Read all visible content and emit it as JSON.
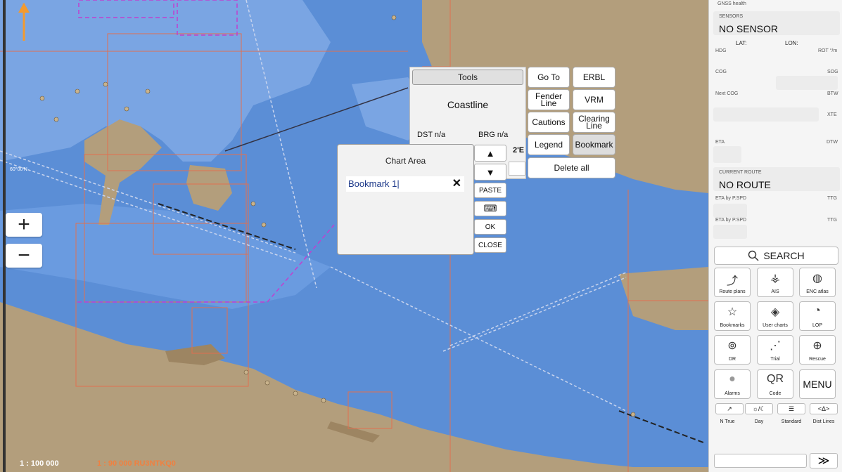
{
  "map": {
    "scale_main": "1 : 100 000",
    "scale_cell": "1 : 90 000  RU3NTKQ0",
    "lat_label": "60°00'N",
    "zoom_in": "+",
    "zoom_out": "−"
  },
  "tools": {
    "header": "Tools",
    "title": "Coastline",
    "dst_label": "DST  n/a",
    "brg_label": "BRG  n/a",
    "coord_fragment": "2'E",
    "buttons": {
      "goto": "Go To",
      "erbl": "ERBL",
      "fender": "Fender Line",
      "vrm": "VRM",
      "cautions": "Cautions",
      "clearing": "Clearing Line",
      "legend": "Legend",
      "bookmark": "Bookmark",
      "delete_all": "Delete all"
    }
  },
  "dialog": {
    "title": "Chart Area",
    "input_value": "Bookmark 1|",
    "clear": "✕",
    "up": "▲",
    "down": "▼",
    "paste": "PASTE",
    "keyboard": "⌨",
    "ok": "OK",
    "close": "CLOSE"
  },
  "panel": {
    "gnss": "GNSS health",
    "sensors_label": "SENSORS",
    "sensors_value": "NO SENSOR",
    "lat": "LAT:",
    "lon": "LON:",
    "hdg": "HDG",
    "rot": "ROT °/m",
    "cog": "COG",
    "sog": "SOG",
    "next_cog": "Next COG",
    "btw": "BTW",
    "xte": "XTE",
    "eta": "ETA",
    "dtw": "DTW",
    "current_route_label": "CURRENT ROUTE",
    "current_route_value": "NO ROUTE",
    "eta_pspd_1": "ETA by P.SPD",
    "ttg_1": "TTG",
    "eta_pspd_2": "ETA by P.SPD",
    "ttg_2": "TTG",
    "search": "SEARCH",
    "grid": [
      {
        "label": "Route plans",
        "icon": "route-icon"
      },
      {
        "label": "AIS",
        "icon": "ais-icon"
      },
      {
        "label": "ENC atlas",
        "icon": "globe-icon"
      },
      {
        "label": "Bookmarks",
        "icon": "star-icon"
      },
      {
        "label": "User charts",
        "icon": "layers-icon"
      },
      {
        "label": "LOP",
        "icon": "compass-icon"
      },
      {
        "label": "DR",
        "icon": "dr-icon"
      },
      {
        "label": "Trial",
        "icon": "trial-icon"
      },
      {
        "label": "Rescue",
        "icon": "lifebuoy-icon"
      },
      {
        "label": "Alarms",
        "icon": "alarm-icon"
      },
      {
        "label": "Code",
        "icon": "qr-icon"
      },
      {
        "label": "MENU",
        "icon": "menu-icon"
      }
    ],
    "qr_glyph": "QR",
    "bottom": [
      {
        "label": "N True",
        "glyph": "↗"
      },
      {
        "label": "Day",
        "glyph": "☼/☾"
      },
      {
        "label": "Standard",
        "glyph": "☰"
      },
      {
        "label": "Dist Lines",
        "glyph": "<Δ>"
      }
    ],
    "next": "≫"
  }
}
